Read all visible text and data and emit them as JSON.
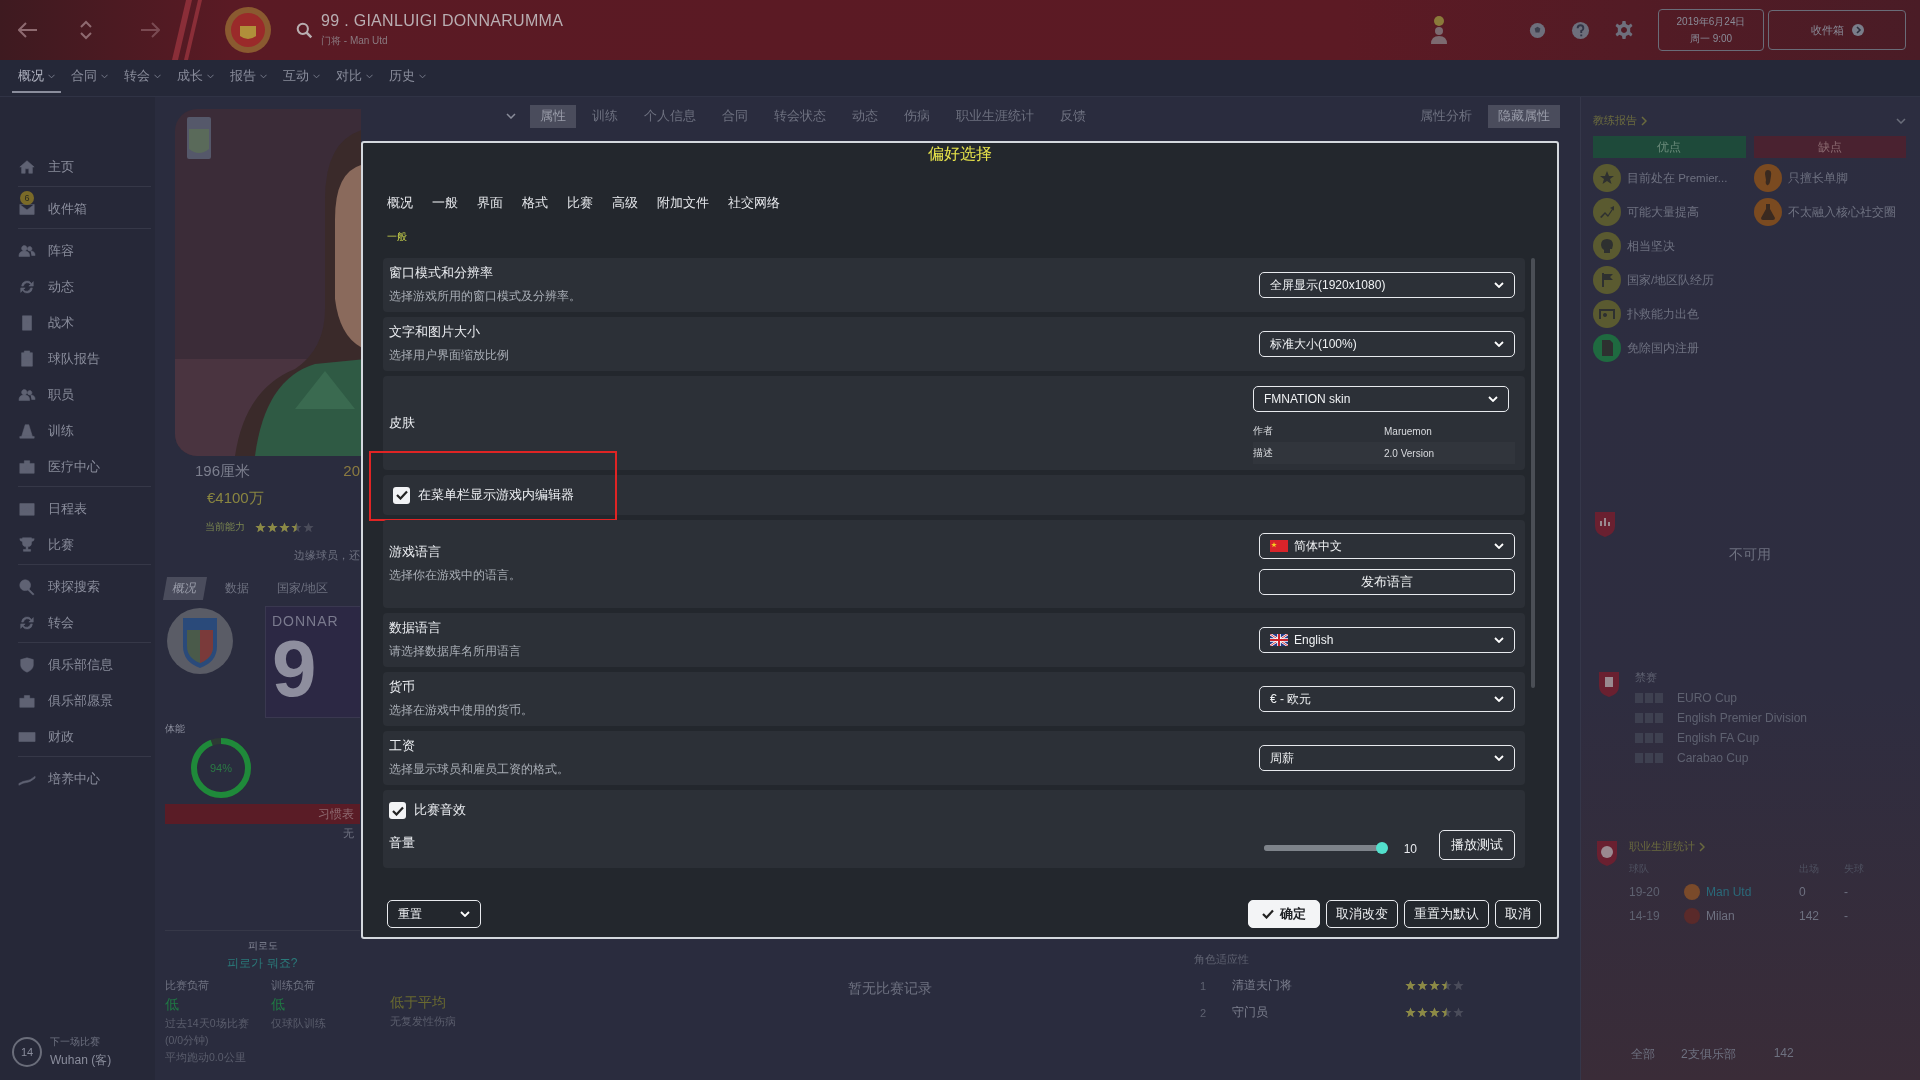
{
  "top_bar": {
    "title": "99 . GIANLUIGI DONNARUMMA",
    "subtitle": "门将 - Man Utd",
    "date": "2019年6月24日",
    "time": "周一 9:00",
    "inbox": "收件箱"
  },
  "menu": [
    {
      "label": "概况",
      "selected": true
    },
    {
      "label": "合同",
      "selected": false
    },
    {
      "label": "转会",
      "selected": false
    },
    {
      "label": "成长",
      "selected": false
    },
    {
      "label": "报告",
      "selected": false
    },
    {
      "label": "互动",
      "selected": false
    },
    {
      "label": "对比",
      "selected": false
    },
    {
      "label": "历史",
      "selected": false
    }
  ],
  "sidebar": {
    "groups": [
      {
        "items": [
          {
            "label": "主页"
          }
        ]
      },
      {
        "items": [
          {
            "label": "收件箱",
            "badge": "6"
          }
        ]
      },
      {
        "items": [
          {
            "label": "阵容"
          },
          {
            "label": "动态"
          },
          {
            "label": "战术"
          },
          {
            "label": "球队报告"
          },
          {
            "label": "职员"
          },
          {
            "label": "训练"
          },
          {
            "label": "医疗中心"
          }
        ]
      },
      {
        "items": [
          {
            "label": "日程表"
          },
          {
            "label": "比赛"
          }
        ]
      },
      {
        "items": [
          {
            "label": "球探搜索"
          },
          {
            "label": "转会"
          }
        ]
      },
      {
        "items": [
          {
            "label": "俱乐部信息"
          },
          {
            "label": "俱乐部愿景"
          },
          {
            "label": "财政"
          }
        ]
      },
      {
        "items": [
          {
            "label": "培养中心"
          }
        ]
      }
    ]
  },
  "next_match": {
    "label": "下一场比赛",
    "opponent": "Wuhan (客)",
    "days": "14"
  },
  "profile_tabs": [
    {
      "label": "属性",
      "selected": true
    },
    {
      "label": "训练",
      "selected": false
    },
    {
      "label": "个人信息",
      "selected": false
    },
    {
      "label": "合同",
      "selected": false
    },
    {
      "label": "转会状态",
      "selected": false
    },
    {
      "label": "动态",
      "selected": false
    },
    {
      "label": "伤病",
      "selected": false
    },
    {
      "label": "职业生涯统计",
      "selected": false
    },
    {
      "label": "反馈",
      "selected": false
    }
  ],
  "analysis_tabs": [
    {
      "label": "属性分析",
      "selected": false
    },
    {
      "label": "隐藏属性",
      "selected": true
    }
  ],
  "player_card": {
    "kind": "picture",
    "height": "196厘米",
    "age": "20",
    "value": "€4100万",
    "ability_label": "当前能力",
    "stars": 3.5,
    "role_text": "边缘球员，还",
    "tabs": [
      {
        "label": "概况",
        "selected": true
      },
      {
        "label": "数据",
        "selected": false
      },
      {
        "label": "国家/地区",
        "selected": false
      }
    ],
    "name_plate": "DONNAR",
    "number": "9",
    "fitness_label": "体能",
    "fitness": {
      "level": 0.94,
      "reading": "94%"
    },
    "habit_label": "习惯表",
    "habit_value": "无"
  },
  "fatigue": {
    "title": "피로도",
    "link": "피로가 뭐죠?",
    "columns": [
      {
        "label": "比赛负荷",
        "value": "低",
        "notes": [
          "过去14天0场比赛",
          "(0/0分钟)",
          "平均跑动0.0公里"
        ]
      },
      {
        "label": "训练负荷",
        "value": "低",
        "notes": [
          "仅球队训练"
        ]
      },
      {
        "value": "低于平均",
        "notes": [
          "无复发性伤病"
        ]
      }
    ]
  },
  "match_record": "暂无比赛记录",
  "roles": {
    "title": "角色适应性",
    "items": [
      {
        "rank": "1",
        "name": "清道夫门将",
        "stars": 3.5
      },
      {
        "rank": "2",
        "name": "守门员",
        "stars": 3.5
      }
    ]
  },
  "coach_report": {
    "title": "教练报告",
    "strengths_label": "优点",
    "weaknesses_label": "缺点",
    "strengths": [
      "目前处在 Premier...",
      "可能大量提高",
      "相当坚决",
      "国家/地区队经历",
      "扑救能力出色",
      "免除国内注册"
    ],
    "weaknesses": [
      "只擅长单脚",
      "不太融入核心社交圈"
    ]
  },
  "stats_panel": {
    "message": "不可用"
  },
  "bans": {
    "title": "禁赛",
    "items": [
      "EURO Cup",
      "English Premier Division",
      "English FA Cup",
      "Carabao Cup"
    ]
  },
  "career": {
    "title": "职业生涯统计",
    "columns": [
      "球队",
      "出场",
      "失球"
    ],
    "rows": [
      {
        "years": "19-20",
        "club": "Man Utd",
        "apps": "0",
        "conceded": "-",
        "current": true
      },
      {
        "years": "14-19",
        "club": "Milan",
        "apps": "142",
        "conceded": "-",
        "current": false
      }
    ]
  },
  "panel_footer": [
    "全部",
    "2支俱乐部",
    "142"
  ],
  "dialog": {
    "title": "偏好选择",
    "tabs": [
      "概况",
      "一般",
      "界面",
      "格式",
      "比赛",
      "高级",
      "附加文件",
      "社交网络"
    ],
    "section": "一般",
    "rows": [
      {
        "kind": "dropdown",
        "title": "窗口模式和分辨率",
        "description": "选择游戏所用的窗口模式及分辨率。",
        "value": "全屏显示(1920x1080)"
      },
      {
        "kind": "dropdown",
        "title": "文字和图片大小",
        "description": "选择用户界面缩放比例",
        "value": "标准大小(100%)"
      },
      {
        "kind": "skin",
        "title": "皮肤",
        "value": "FMNATION skin",
        "details": [
          {
            "label": "作者",
            "value": "Maruemon"
          },
          {
            "label": "描述",
            "value": "2.0 Version"
          }
        ]
      },
      {
        "kind": "checkbox",
        "label": "在菜单栏显示游戏内编辑器",
        "checked": true,
        "highlighted": true
      },
      {
        "kind": "language",
        "title": "游戏语言",
        "description": "选择你在游戏中的语言。",
        "value": "简体中文",
        "button": "发布语言"
      },
      {
        "kind": "dropdown",
        "title": "数据语言",
        "description": "请选择数据库名所用语言",
        "value": "English"
      },
      {
        "kind": "dropdown",
        "title": "货币",
        "description": "选择在游戏中使用的货币。",
        "value": "€ - 欧元"
      },
      {
        "kind": "dropdown",
        "title": "工资",
        "description": "选择显示球员和雇员工资的格式。",
        "value": "周薪"
      },
      {
        "kind": "sound",
        "checkbox": {
          "label": "比赛音效",
          "checked": true
        },
        "volume": {
          "label": "音量",
          "level": 1,
          "reading": "10"
        },
        "button": "播放测试"
      }
    ],
    "reset": "重置",
    "buttons": [
      {
        "label": "确定",
        "primary": true
      },
      {
        "label": "取消改变",
        "primary": false
      },
      {
        "label": "重置为默认",
        "primary": false
      },
      {
        "label": "取消",
        "primary": false
      }
    ]
  }
}
